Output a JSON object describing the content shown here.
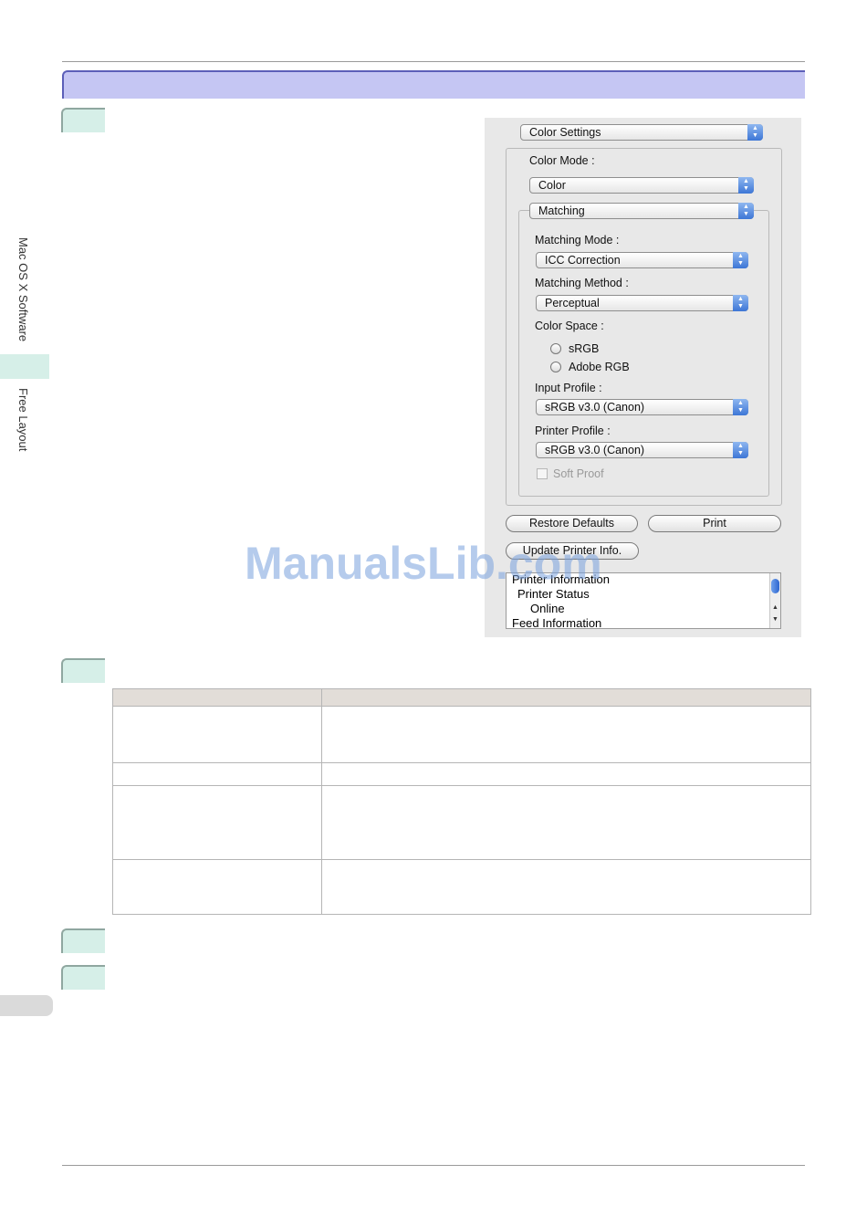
{
  "side_nav": {
    "chapter_label": "Mac OS X Software",
    "section_label": "Free Layout"
  },
  "dialog": {
    "panel_select": "Color Settings",
    "color_mode_label": "Color Mode :",
    "color_mode_value": "Color",
    "matching_select": "Matching",
    "matching_mode_label": "Matching Mode :",
    "matching_mode_value": "ICC Correction",
    "matching_method_label": "Matching Method :",
    "matching_method_value": "Perceptual",
    "color_space_label": "Color Space :",
    "color_space_options": [
      "sRGB",
      "Adobe RGB"
    ],
    "input_profile_label": "Input Profile :",
    "input_profile_value": "sRGB v3.0 (Canon)",
    "printer_profile_label": "Printer Profile :",
    "printer_profile_value": "sRGB v3.0 (Canon)",
    "soft_proof_label": "Soft Proof",
    "restore_defaults_label": "Restore Defaults",
    "print_label": "Print",
    "update_printer_info_label": "Update Printer Info.",
    "printer_info_items": [
      "Printer Information",
      "Printer Status",
      "Online",
      "Feed Information"
    ]
  },
  "watermark": "ManualsLib.com",
  "colors": {
    "section_bar": "#c5c6f3",
    "step_marker": "#d6efe8",
    "table_header": "#e2ddd8"
  }
}
